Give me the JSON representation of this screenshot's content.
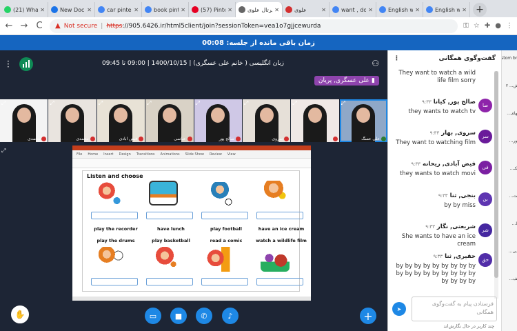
{
  "browser": {
    "tabs": [
      {
        "label": "(21) What",
        "color": "#25d366"
      },
      {
        "label": "New Doc",
        "color": "#1a73e8"
      },
      {
        "label": "car pinter",
        "color": "#4285f4"
      },
      {
        "label": "book pinte",
        "color": "#4285f4"
      },
      {
        "label": "(57) Pinte",
        "color": "#e60023"
      },
      {
        "label": "پرتال علوی",
        "color": "#666666"
      },
      {
        "label": "علوی",
        "color": "#d32f2f"
      },
      {
        "label": "want , do",
        "color": "#4285f4"
      },
      {
        "label": "English w",
        "color": "#4285f4"
      },
      {
        "label": "English w",
        "color": "#4285f4"
      }
    ],
    "new_tab": "+",
    "nav_back": "←",
    "nav_forward": "→",
    "nav_reload": "C",
    "security_label": "Not secure",
    "url_struck": "https",
    "url_rest": "://905.6426.ir/html5client/join?sessionToken=vea1o7gjjcewurda"
  },
  "banner": {
    "text": "زمان باقی مانده از جلسه: 00:08"
  },
  "meeting": {
    "title": "زبان انگلیسی ( خانم علی عسگری) | 1400/10/15 | 09:00 تا 09:45",
    "presenter": "علی عسگری, پریان",
    "participants": [
      {
        "name": "محمدی",
        "mic": false
      },
      {
        "name": "محمدی",
        "mic": false
      },
      {
        "name": "فیض آبادی",
        "mic": false
      },
      {
        "name": "عباسی",
        "mic": false
      },
      {
        "name": "صالح پور",
        "mic": false
      },
      {
        "name": "سروی",
        "mic": false
      },
      {
        "name": "",
        "mic": false
      },
      {
        "name": "علی عسگ",
        "mic": true
      }
    ]
  },
  "slide": {
    "ribbon": [
      "File",
      "Home",
      "Insert",
      "Design",
      "Transitions",
      "Animations",
      "Slide Show",
      "Review",
      "View"
    ],
    "title": "Listen and choose",
    "row1": [
      "play the recorder",
      "have lunch",
      "play football",
      "have an ice cream"
    ],
    "row2": [
      "play the drums",
      "play basketball",
      "read a comic",
      "watch a wildlife film"
    ]
  },
  "chat": {
    "header": "گفت‌وگوی همگانی",
    "messages": [
      {
        "initials": "",
        "name": "",
        "time": "",
        "text": "They want to watch a wild life film sorry",
        "color": "#7b1fa2"
      },
      {
        "initials": "صا",
        "name": "صالح پور, کیانا",
        "time": "۹:۳۳",
        "text": "they wants to watch tv",
        "color": "#8e24aa"
      },
      {
        "initials": "سر",
        "name": "سروی, بهار",
        "time": "۹:۳۳",
        "text": "They want to watching film",
        "color": "#6a1b9a"
      },
      {
        "initials": "فی",
        "name": "فیض آبادی, ریحانه",
        "time": "۹:۳۳",
        "text": "they wants to watch movi",
        "color": "#7b1fa2"
      },
      {
        "initials": "بن",
        "name": "بنجی, ثنا",
        "time": "۹:۳۳",
        "text": "by by miss",
        "color": "#5e35b1"
      },
      {
        "initials": "شر",
        "name": "شریعتی, نگار",
        "time": "۹:۳۳",
        "text": "She wants to have an ice cream",
        "color": "#4527a0"
      },
      {
        "initials": "حق",
        "name": "حقیری, ثنا",
        "time": "۹:۳۳",
        "text": "by by by by by by by by by by by by by by by by by by by by by by",
        "color": "#512da8"
      }
    ],
    "input_placeholder": "فرستادن پیام به گفت‌وگوی همگانی",
    "typing": "چند کاربر در حال نگارش‌اند"
  },
  "right_strip": {
    "items": [
      "ustom bri",
      "ش... ۲",
      "ـهای...",
      "بور...",
      "ـکـ...",
      "ـت...",
      "ـا...",
      "ــی...",
      "ـف..."
    ]
  }
}
